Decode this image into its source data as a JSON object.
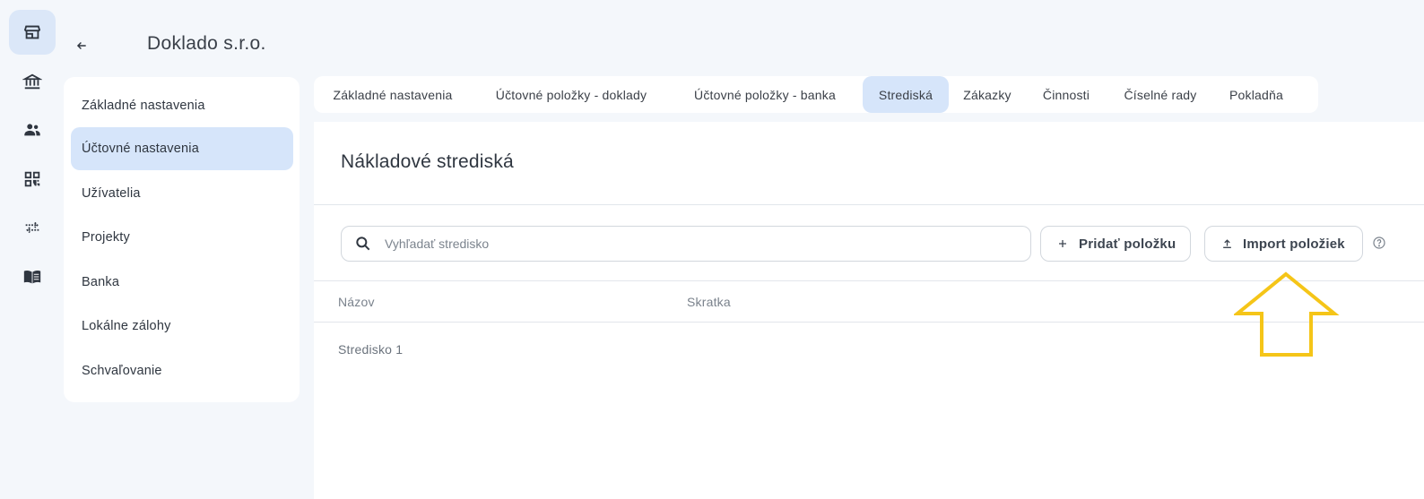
{
  "company": {
    "name": "Doklado s.r.o."
  },
  "rail": {
    "icons": [
      "store-icon",
      "bank-icon",
      "users-icon",
      "qr-code-icon",
      "transfer-icon",
      "book-icon"
    ]
  },
  "sidebar": {
    "items": [
      {
        "label": "Základné nastavenia"
      },
      {
        "label": "Účtovné nastavenia"
      },
      {
        "label": "Užívatelia"
      },
      {
        "label": "Projekty"
      },
      {
        "label": "Banka"
      },
      {
        "label": "Lokálne zálohy"
      },
      {
        "label": "Schvaľovanie"
      }
    ],
    "active_index": 1
  },
  "tabs": {
    "items": [
      {
        "label": "Základné nastavenia"
      },
      {
        "label": "Účtovné položky - doklady"
      },
      {
        "label": "Účtovné položky - banka"
      },
      {
        "label": "Strediská"
      },
      {
        "label": "Zákazky"
      },
      {
        "label": "Činnosti"
      },
      {
        "label": "Číselné rady"
      },
      {
        "label": "Pokladňa"
      }
    ],
    "active_index": 3
  },
  "panel": {
    "title": "Nákladové strediská",
    "search": {
      "placeholder": "Vyhľadať stredisko",
      "value": ""
    },
    "add_button": "Pridať položku",
    "import_button": "Import položiek"
  },
  "table": {
    "columns": [
      "Názov",
      "Skratka"
    ],
    "rows": [
      {
        "name": "Stredisko 1",
        "short": ""
      }
    ]
  },
  "colors": {
    "accent_bg": "#d6e5fa",
    "highlight_arrow": "#f5c518",
    "page_bg": "#f4f7fb"
  }
}
